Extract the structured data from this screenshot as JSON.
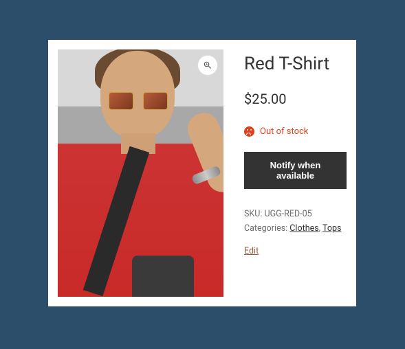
{
  "product": {
    "title": "Red T-Shirt",
    "price": "$25.00",
    "stock_status": "Out of stock",
    "notify_label": "Notify when available",
    "sku_label": "SKU:",
    "sku_value": "UGG-RED-05",
    "categories_label": "Categories:",
    "category1": "Clothes",
    "category_separator": ", ",
    "category2": "Tops",
    "edit_label": "Edit"
  }
}
